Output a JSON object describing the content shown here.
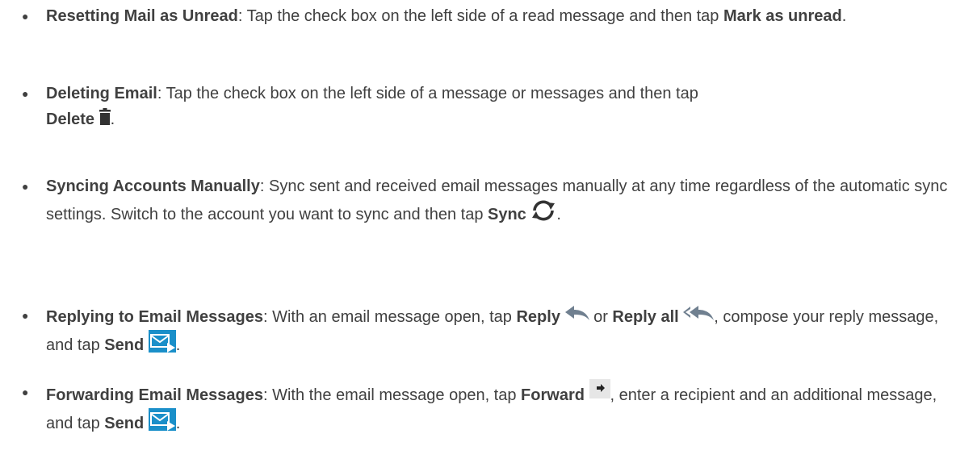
{
  "items": [
    {
      "title": "Resetting Mail as Unread",
      "text1": ": Tap the check box on the left side of a read message and then tap ",
      "action1": "Mark as unread",
      "text2": "."
    },
    {
      "title": "Deleting Email",
      "text1": ": Tap the check box on the left side of a message or messages and then tap ",
      "action1": "Delete",
      "icon1": "trash-icon",
      "text2": "."
    },
    {
      "title": "Syncing Accounts Manually",
      "text1": ": Sync sent and received email messages manually at any time regardless of the automatic sync settings. Switch to the account you want to sync and then tap ",
      "action1": "Sync",
      "icon1": "sync-icon",
      "text2": "."
    },
    {
      "title": "Replying to Email Messages",
      "text1": ": With an email message open, tap ",
      "action1": "Reply",
      "icon1": "reply-icon",
      "text2": " or ",
      "action2": "Reply all",
      "icon2": "reply-all-icon",
      "text3": ", compose your reply message, and tap ",
      "action3": "Send",
      "icon3": "send-icon",
      "text4": "."
    },
    {
      "title": "Forwarding Email Messages",
      "text1": ": With the email message open, tap ",
      "action1": "Forward",
      "icon1": "forward-icon",
      "text2": ", enter a recipient and an additional message, and tap ",
      "action2": "Send",
      "icon2": "send-icon",
      "text3": "."
    }
  ],
  "colors": {
    "text": "#404040",
    "icon_dark": "#333333",
    "reply_icon": "#708090",
    "send_icon": "#1a8fc9",
    "forward_bg": "#e6e6e6"
  }
}
